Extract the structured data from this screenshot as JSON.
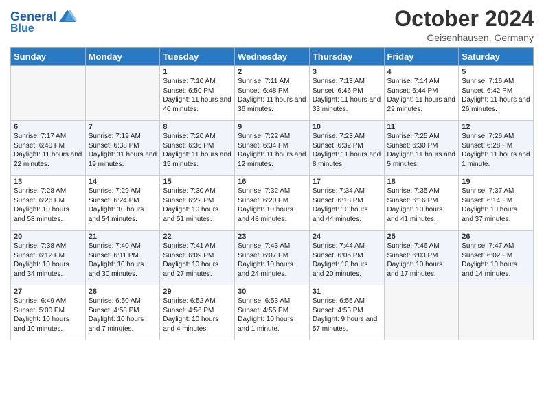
{
  "header": {
    "logo_line1": "General",
    "logo_line2": "Blue",
    "month_title": "October 2024",
    "location": "Geisenhausen, Germany"
  },
  "weekdays": [
    "Sunday",
    "Monday",
    "Tuesday",
    "Wednesday",
    "Thursday",
    "Friday",
    "Saturday"
  ],
  "weeks": [
    [
      {
        "day": "",
        "info": ""
      },
      {
        "day": "",
        "info": ""
      },
      {
        "day": "1",
        "info": "Sunrise: 7:10 AM\nSunset: 6:50 PM\nDaylight: 11 hours and 40 minutes."
      },
      {
        "day": "2",
        "info": "Sunrise: 7:11 AM\nSunset: 6:48 PM\nDaylight: 11 hours and 36 minutes."
      },
      {
        "day": "3",
        "info": "Sunrise: 7:13 AM\nSunset: 6:46 PM\nDaylight: 11 hours and 33 minutes."
      },
      {
        "day": "4",
        "info": "Sunrise: 7:14 AM\nSunset: 6:44 PM\nDaylight: 11 hours and 29 minutes."
      },
      {
        "day": "5",
        "info": "Sunrise: 7:16 AM\nSunset: 6:42 PM\nDaylight: 11 hours and 26 minutes."
      }
    ],
    [
      {
        "day": "6",
        "info": "Sunrise: 7:17 AM\nSunset: 6:40 PM\nDaylight: 11 hours and 22 minutes."
      },
      {
        "day": "7",
        "info": "Sunrise: 7:19 AM\nSunset: 6:38 PM\nDaylight: 11 hours and 19 minutes."
      },
      {
        "day": "8",
        "info": "Sunrise: 7:20 AM\nSunset: 6:36 PM\nDaylight: 11 hours and 15 minutes."
      },
      {
        "day": "9",
        "info": "Sunrise: 7:22 AM\nSunset: 6:34 PM\nDaylight: 11 hours and 12 minutes."
      },
      {
        "day": "10",
        "info": "Sunrise: 7:23 AM\nSunset: 6:32 PM\nDaylight: 11 hours and 8 minutes."
      },
      {
        "day": "11",
        "info": "Sunrise: 7:25 AM\nSunset: 6:30 PM\nDaylight: 11 hours and 5 minutes."
      },
      {
        "day": "12",
        "info": "Sunrise: 7:26 AM\nSunset: 6:28 PM\nDaylight: 11 hours and 1 minute."
      }
    ],
    [
      {
        "day": "13",
        "info": "Sunrise: 7:28 AM\nSunset: 6:26 PM\nDaylight: 10 hours and 58 minutes."
      },
      {
        "day": "14",
        "info": "Sunrise: 7:29 AM\nSunset: 6:24 PM\nDaylight: 10 hours and 54 minutes."
      },
      {
        "day": "15",
        "info": "Sunrise: 7:30 AM\nSunset: 6:22 PM\nDaylight: 10 hours and 51 minutes."
      },
      {
        "day": "16",
        "info": "Sunrise: 7:32 AM\nSunset: 6:20 PM\nDaylight: 10 hours and 48 minutes."
      },
      {
        "day": "17",
        "info": "Sunrise: 7:34 AM\nSunset: 6:18 PM\nDaylight: 10 hours and 44 minutes."
      },
      {
        "day": "18",
        "info": "Sunrise: 7:35 AM\nSunset: 6:16 PM\nDaylight: 10 hours and 41 minutes."
      },
      {
        "day": "19",
        "info": "Sunrise: 7:37 AM\nSunset: 6:14 PM\nDaylight: 10 hours and 37 minutes."
      }
    ],
    [
      {
        "day": "20",
        "info": "Sunrise: 7:38 AM\nSunset: 6:12 PM\nDaylight: 10 hours and 34 minutes."
      },
      {
        "day": "21",
        "info": "Sunrise: 7:40 AM\nSunset: 6:11 PM\nDaylight: 10 hours and 30 minutes."
      },
      {
        "day": "22",
        "info": "Sunrise: 7:41 AM\nSunset: 6:09 PM\nDaylight: 10 hours and 27 minutes."
      },
      {
        "day": "23",
        "info": "Sunrise: 7:43 AM\nSunset: 6:07 PM\nDaylight: 10 hours and 24 minutes."
      },
      {
        "day": "24",
        "info": "Sunrise: 7:44 AM\nSunset: 6:05 PM\nDaylight: 10 hours and 20 minutes."
      },
      {
        "day": "25",
        "info": "Sunrise: 7:46 AM\nSunset: 6:03 PM\nDaylight: 10 hours and 17 minutes."
      },
      {
        "day": "26",
        "info": "Sunrise: 7:47 AM\nSunset: 6:02 PM\nDaylight: 10 hours and 14 minutes."
      }
    ],
    [
      {
        "day": "27",
        "info": "Sunrise: 6:49 AM\nSunset: 5:00 PM\nDaylight: 10 hours and 10 minutes."
      },
      {
        "day": "28",
        "info": "Sunrise: 6:50 AM\nSunset: 4:58 PM\nDaylight: 10 hours and 7 minutes."
      },
      {
        "day": "29",
        "info": "Sunrise: 6:52 AM\nSunset: 4:56 PM\nDaylight: 10 hours and 4 minutes."
      },
      {
        "day": "30",
        "info": "Sunrise: 6:53 AM\nSunset: 4:55 PM\nDaylight: 10 hours and 1 minute."
      },
      {
        "day": "31",
        "info": "Sunrise: 6:55 AM\nSunset: 4:53 PM\nDaylight: 9 hours and 57 minutes."
      },
      {
        "day": "",
        "info": ""
      },
      {
        "day": "",
        "info": ""
      }
    ]
  ]
}
